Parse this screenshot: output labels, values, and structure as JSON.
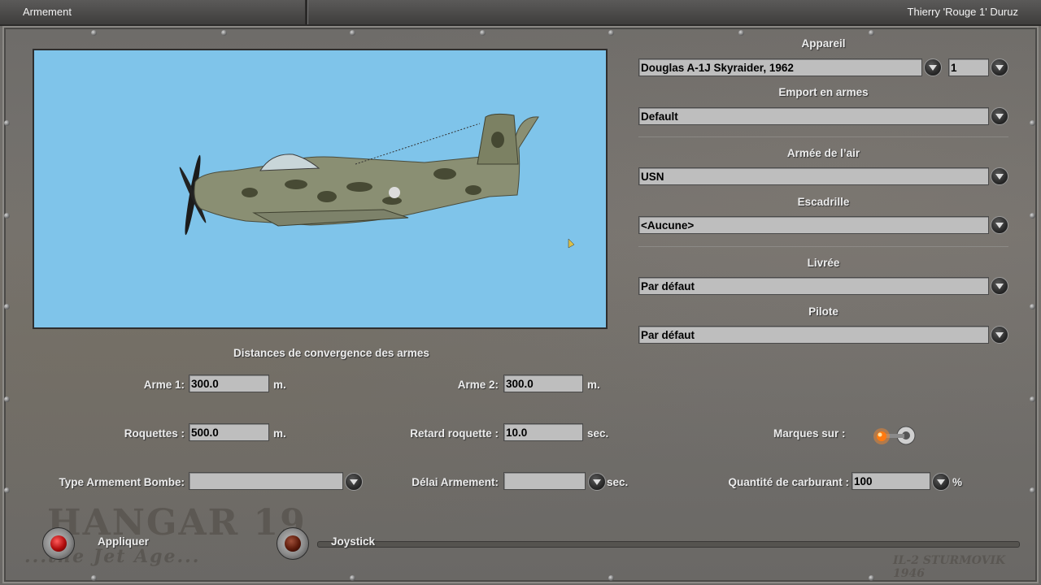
{
  "window": {
    "title_left": "Armement",
    "title_right": "Thierry 'Rouge 1' Duruz"
  },
  "aircraft": {
    "label": "Appareil",
    "value": "Douglas A-1J Skyraider, 1962",
    "count": "1"
  },
  "loadout": {
    "label": "Emport en armes",
    "value": "Default"
  },
  "airforce": {
    "label": "Armée de l’air",
    "value": "USN"
  },
  "squadron": {
    "label": "Escadrille",
    "value": "<Aucune>"
  },
  "livery": {
    "label": "Livrée",
    "value": "Par défaut"
  },
  "pilot": {
    "label": "Pilote",
    "value": "Par défaut"
  },
  "convergence": {
    "heading": "Distances de convergence des armes",
    "gun1_label": "Arme 1:",
    "gun1_value": "300.0",
    "gun1_unit": "m.",
    "gun2_label": "Arme 2:",
    "gun2_value": "300.0",
    "gun2_unit": "m.",
    "rockets_label": "Roquettes :",
    "rockets_value": "500.0",
    "rockets_unit": "m.",
    "rocket_delay_label": "Retard roquette :",
    "rocket_delay_value": "10.0",
    "rocket_delay_unit": "sec.",
    "bomb_type_label": "Type Armement Bombe:",
    "bomb_type_value": "",
    "arming_delay_label": "Délai Armement:",
    "arming_delay_value": "",
    "arming_delay_unit": "sec."
  },
  "markings": {
    "label": "Marques sur :",
    "state": "on"
  },
  "fuel": {
    "label": "Quantité de carburant :",
    "value": "100",
    "unit": "%"
  },
  "buttons": {
    "apply": "Appliquer",
    "joystick": "Joystick"
  },
  "watermark": {
    "logo_text": "HANGAR 19",
    "tagline": "...the Jet Age...",
    "corner": "IL-2 STURMOVIK 1946"
  },
  "colors": {
    "preview_bg": "#7fc4ea",
    "field_bg": "#bebebe",
    "button_core": "#b00d0d"
  },
  "icons": [
    "dropdown-arrow-icon",
    "aircraft-image",
    "markings-toggle-icon",
    "apply-button-icon",
    "joystick-button-icon"
  ]
}
